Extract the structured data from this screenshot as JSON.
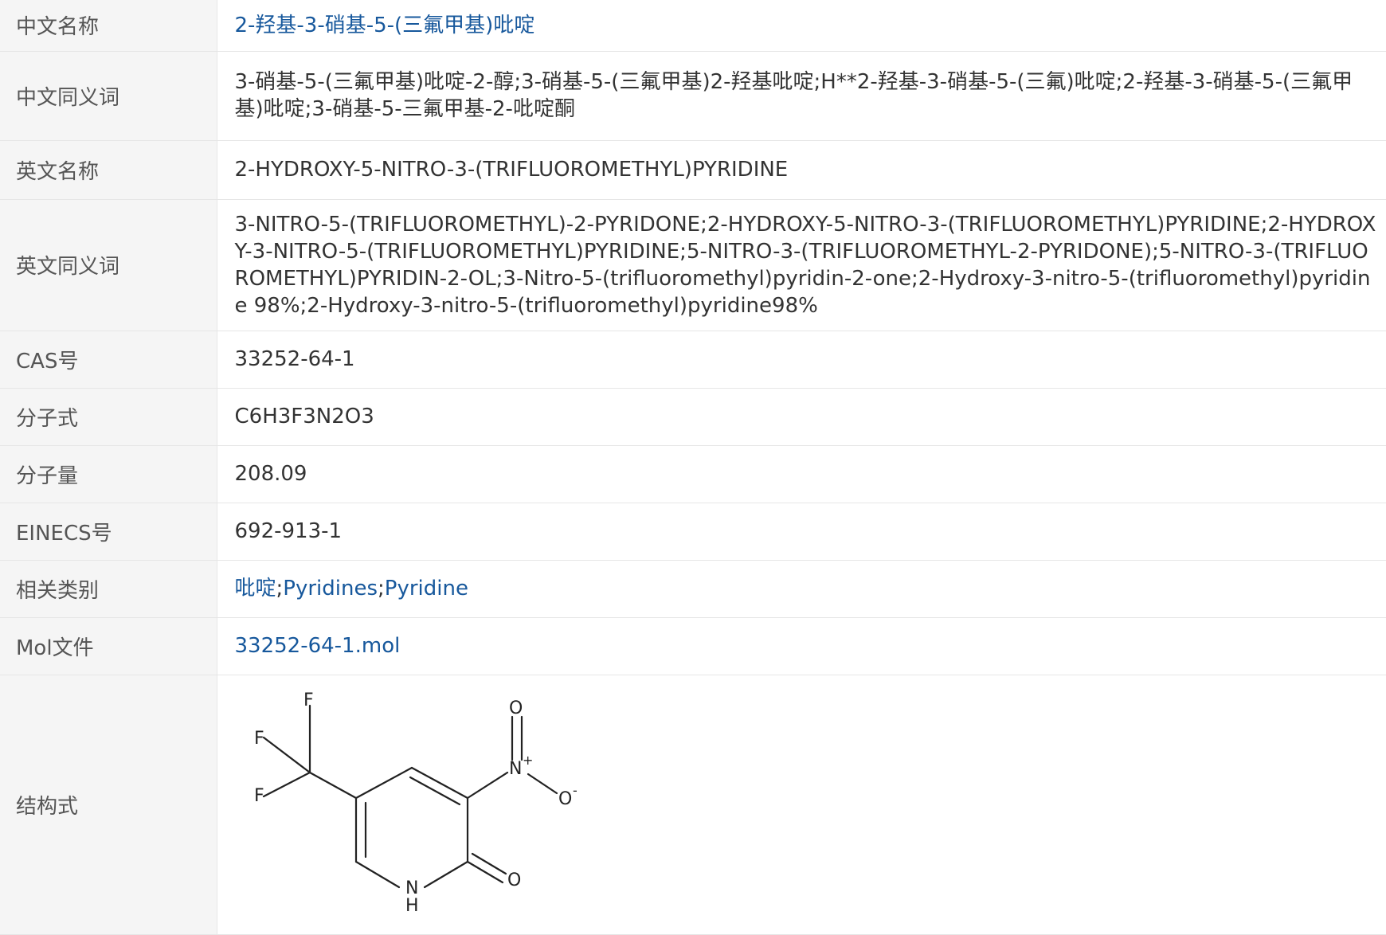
{
  "rows": {
    "cn_name": {
      "label": "中文名称",
      "value": "2-羟基-3-硝基-5-(三氟甲基)吡啶"
    },
    "cn_synonyms": {
      "label": "中文同义词",
      "value": "3-硝基-5-(三氟甲基)吡啶-2-醇;3-硝基-5-(三氟甲基)2-羟基吡啶;H**2-羟基-3-硝基-5-(三氟)吡啶;2-羟基-3-硝基-5-(三氟甲基)吡啶;3-硝基-5-三氟甲基-2-吡啶酮"
    },
    "en_name": {
      "label": "英文名称",
      "value": "2-HYDROXY-5-NITRO-3-(TRIFLUOROMETHYL)PYRIDINE"
    },
    "en_synonyms": {
      "label": "英文同义词",
      "value": "3-NITRO-5-(TRIFLUOROMETHYL)-2-PYRIDONE;2-HYDROXY-5-NITRO-3-(TRIFLUOROMETHYL)PYRIDINE;2-HYDROXY-3-NITRO-5-(TRIFLUOROMETHYL)PYRIDINE;5-NITRO-3-(TRIFLUOROMETHYL-2-PYRIDONE);5-NITRO-3-(TRIFLUOROMETHYL)PYRIDIN-2-OL;3-Nitro-5-(trifluoromethyl)pyridin-2-one;2-Hydroxy-3-nitro-5-(trifluoromethyl)pyridine 98%;2-Hydroxy-3-nitro-5-(trifluoromethyl)pyridine98%"
    },
    "cas": {
      "label": "CAS号",
      "value": "33252-64-1"
    },
    "formula": {
      "label": "分子式",
      "value": "C6H3F3N2O3"
    },
    "mw": {
      "label": "分子量",
      "value": "208.09"
    },
    "einecs": {
      "label": "EINECS号",
      "value": "692-913-1"
    },
    "category": {
      "label": "相关类别",
      "links": [
        "吡啶",
        "Pyridines",
        "Pyridine"
      ],
      "separator": ";"
    },
    "mol": {
      "label": "Mol文件",
      "value": "33252-64-1.mol"
    },
    "structure": {
      "label": "结构式",
      "atoms": {
        "f_top": "F",
        "f_left": "F",
        "f_bottom": "F",
        "o_top": "O",
        "n_nitro": "N",
        "n_charge": "+",
        "o_minus": "O",
        "o_charge": "-",
        "o_carbonyl": "O",
        "n_ring": "N",
        "h_ring": "H"
      }
    }
  }
}
